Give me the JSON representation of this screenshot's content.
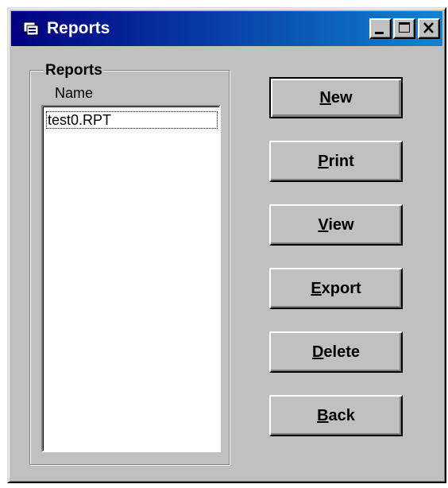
{
  "window": {
    "title": "Reports",
    "controls": {
      "minimize": "_",
      "maximize": "□",
      "close": "✕"
    }
  },
  "group": {
    "label": "Reports",
    "column_header": "Name",
    "items": [
      "test0.RPT"
    ]
  },
  "buttons": [
    {
      "accel": "N",
      "rest": "ew"
    },
    {
      "accel": "P",
      "rest": "rint"
    },
    {
      "accel": "V",
      "rest": "iew"
    },
    {
      "accel": "E",
      "rest": "xport"
    },
    {
      "accel": "D",
      "rest": "elete"
    },
    {
      "accel": "B",
      "rest": "ack"
    }
  ],
  "colors": {
    "titlebar": "#000080",
    "face": "#c0c0c0"
  }
}
